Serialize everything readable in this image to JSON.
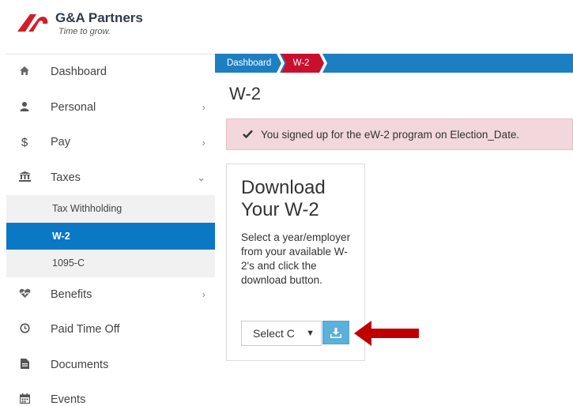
{
  "brand": {
    "name": "G&A Partners",
    "tagline": "Time to grow.",
    "logo_icon": "ga-partners-logo",
    "logo_color": "#d11f2a"
  },
  "sidebar": {
    "items": [
      {
        "label": "Dashboard",
        "icon": "home-icon"
      },
      {
        "label": "Personal",
        "icon": "user-icon",
        "chevron": "›"
      },
      {
        "label": "Pay",
        "icon": "dollar-icon",
        "chevron": "›"
      },
      {
        "label": "Taxes",
        "icon": "bank-icon",
        "chevron": "⌄"
      }
    ],
    "subitems": [
      {
        "label": "Tax Withholding"
      },
      {
        "label": "W-2",
        "active": true
      },
      {
        "label": "1095-C"
      }
    ],
    "items_after": [
      {
        "label": "Benefits",
        "icon": "heartbeat-icon",
        "chevron": "›"
      },
      {
        "label": "Paid Time Off",
        "icon": "clock-icon"
      },
      {
        "label": "Documents",
        "icon": "document-icon"
      },
      {
        "label": "Events",
        "icon": "calendar-icon"
      }
    ],
    "active_color": "#0a78c4"
  },
  "breadcrumb": {
    "items": [
      "Dashboard",
      "W-2"
    ],
    "bar_color": "#1d7fc1",
    "active_color": "#c8102e"
  },
  "page": {
    "title": "W-2"
  },
  "alert": {
    "icon": "checkmark-icon",
    "text": "You signed up for the eW-2 program on Election_Date.",
    "bg_color": "#f2d7dc"
  },
  "card": {
    "title": "Download Your W-2",
    "text": "Select a year/employer from your available W-2's and click the download button.",
    "select_value": "Select C",
    "download_icon": "download-icon",
    "button_color": "#5bb0dc"
  },
  "annotation": {
    "icon": "red-arrow-icon",
    "color": "#c00000"
  }
}
